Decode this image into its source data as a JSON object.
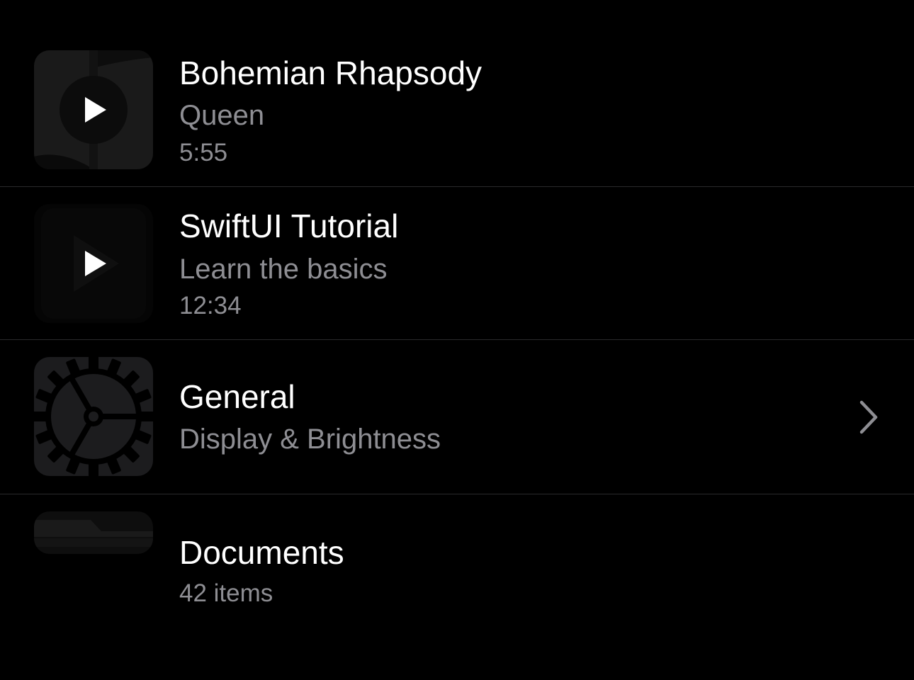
{
  "list": {
    "items": [
      {
        "title": "Bohemian Rhapsody",
        "subtitle": "Queen",
        "duration": "5:55",
        "icon": "play-icon"
      },
      {
        "title": "SwiftUI Tutorial",
        "subtitle": "Learn the basics",
        "duration": "12:34",
        "icon": "play-icon"
      },
      {
        "title": "General",
        "subtitle": "Display & Brightness",
        "icon": "gear-icon",
        "accessory": "chevron-right-icon"
      },
      {
        "title": "Documents",
        "subtitle": "42 items",
        "icon": "folder-icon"
      }
    ]
  },
  "colors": {
    "background": "#000000",
    "primary_text": "#ffffff",
    "secondary_text": "#8e8e93",
    "separator": "#2a2a2c",
    "thumbnail_fill": "#1c1c1e"
  }
}
